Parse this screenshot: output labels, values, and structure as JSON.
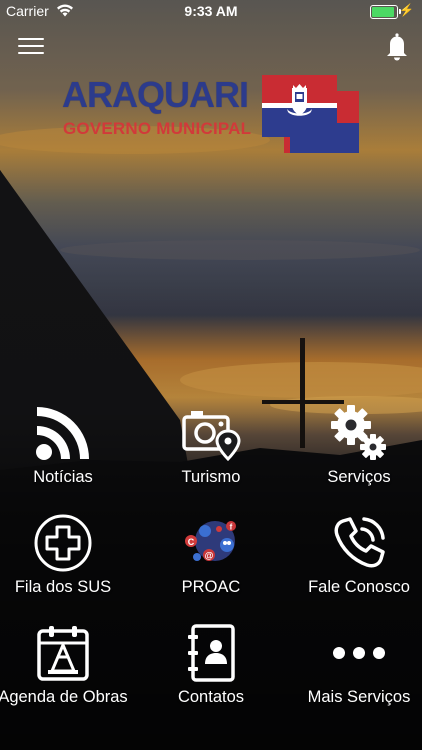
{
  "status_bar": {
    "carrier": "Carrier",
    "time": "9:33 AM",
    "battery_color": "#4cd964"
  },
  "header": {
    "menu_icon": "hamburger-menu-icon",
    "notification_icon": "bell-icon"
  },
  "logo": {
    "title": "ARAQUARI",
    "subtitle": "GOVERNO MUNICIPAL",
    "title_color": "#2c3b8c",
    "subtitle_color": "#d13a3a"
  },
  "menu": {
    "items": [
      {
        "label": "Notícias",
        "icon": "rss-feed-icon"
      },
      {
        "label": "Turismo",
        "icon": "camera-location-icon"
      },
      {
        "label": "Serviços",
        "icon": "gears-icon"
      },
      {
        "label": "Fila dos SUS",
        "icon": "medical-cross-icon"
      },
      {
        "label": "PROAC",
        "icon": "social-network-icon"
      },
      {
        "label": "Fale Conosco",
        "icon": "phone-call-icon"
      },
      {
        "label": "Agenda de Obras",
        "icon": "calendar-cone-icon"
      },
      {
        "label": "Contatos",
        "icon": "address-book-icon"
      },
      {
        "label": "Mais Serviços",
        "icon": "more-dots-icon"
      }
    ]
  }
}
